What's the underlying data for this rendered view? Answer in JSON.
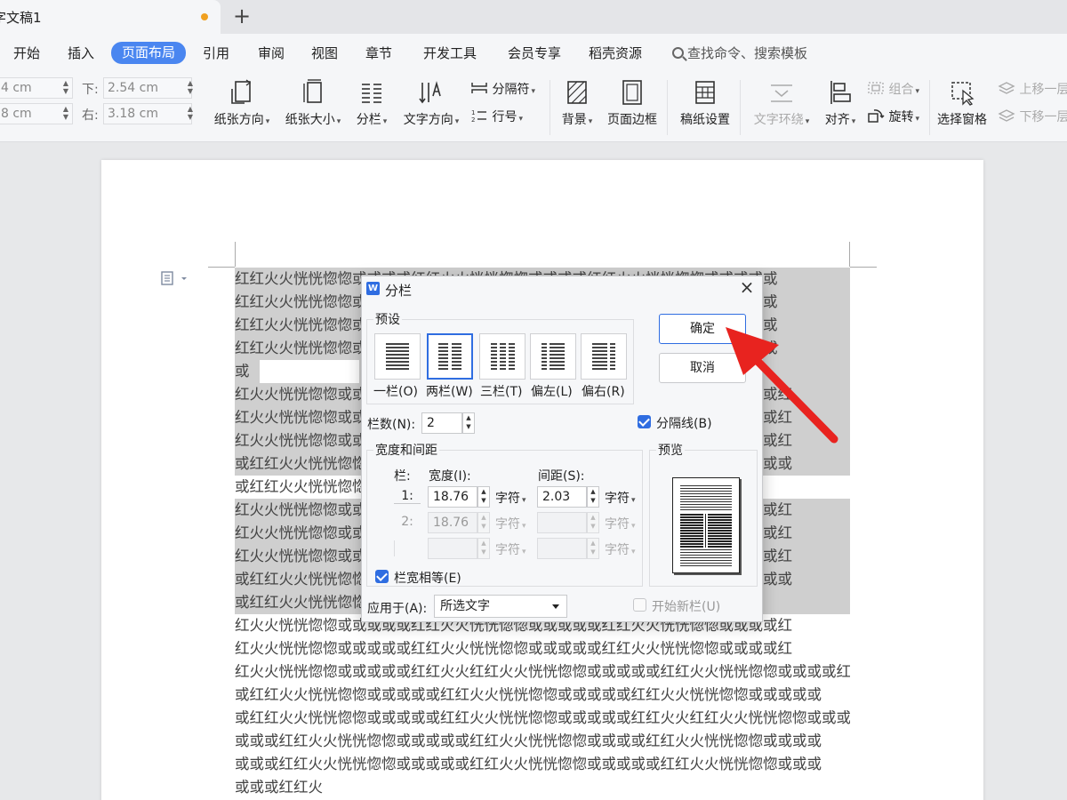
{
  "tabs": {
    "doc_title": "字文稿1",
    "new_tab": "+"
  },
  "menu": {
    "items": [
      "开始",
      "插入",
      "页面布局",
      "引用",
      "审阅",
      "视图",
      "章节",
      "开发工具",
      "会员专享",
      "稻壳资源"
    ],
    "active": "页面布局",
    "search": "查找命令、搜索模板"
  },
  "ribbon": {
    "margins": {
      "top_val": "4 cm",
      "left_val": "8 cm",
      "bottom_label": "下:",
      "bottom_val": "2.54 cm",
      "right_label": "右:",
      "right_val": "3.18 cm"
    },
    "orientation": "纸张方向",
    "size": "纸张大小",
    "columns": "分栏",
    "text_direction": "文字方向",
    "separator": "分隔符",
    "line_number": "行号",
    "background": "背景",
    "page_border": "页面边框",
    "grid_paper": "稿纸设置",
    "text_wrap": "文字环绕",
    "align": "对齐",
    "group": "组合",
    "rotate": "旋转",
    "selection_pane": "选择窗格",
    "bring_forward": "上移一层",
    "send_backward": "下移一层"
  },
  "document": {
    "lines": [
      "红红火火恍恍惚惚或或或或红红火火恍恍惚惚或或或或红红火火恍恍惚惚或或或或或",
      "红红火火恍恍惚惚或或或或红红火火恍恍惚惚或或或或红红火火恍恍惚惚或或或或或",
      "红红火火恍恍惚惚或或或或红红火火恍恍惚惚或或或或红红火火恍恍惚惚或或或或或",
      "红红火火恍恍惚惚或或或或红红火火恍恍惚惚或或或或红红火火恍恍惚惚或或或或或",
      "或",
      "红火火恍恍惚惚或或或或或红红火火恍恍惚惚或或或或或红红火火恍恍惚惚或或或或红",
      "红火火恍恍惚惚或或或或或红红火火恍恍惚惚或或或或或红红火火恍恍惚惚或或或或红",
      "红火火恍恍惚惚或或或或或红红火火恍恍惚惚或或或或或红红火火恍恍惚惚或或或或红",
      "或红红火火恍恍惚惚或或或或红红火火恍恍惚惚或或或或红红火火恍恍惚惚或或或或或",
      "或红红火火恍恍惚惚或或或或红红火火恍恍惚惚或或或或",
      "红火火恍恍惚惚或或或或或红红火火恍恍惚惚或或或或或红红火火恍恍惚惚或或或或红",
      "红火火恍恍惚惚或或或或或红红火火恍恍惚惚或或或或或红红火火恍恍惚惚或或或或红",
      "红火火恍恍惚惚或或或或或红红火火恍恍惚惚或或或或或红红火火恍恍惚惚或或或或红",
      "或红红火火恍恍惚惚或或或或红红火火恍恍惚惚或或或或红红火火恍恍惚惚或或或或或",
      "或红红火火恍恍惚惚或或或或红红火火恍恍惚惚或或或或",
      "红火火恍恍惚惚或或或或或红红火火恍恍惚惚或或或或或红红火火恍恍惚惚或或或或红",
      "红火火恍恍惚惚或或或或或红红火火恍恍惚惚或或或或或红红火火恍恍惚惚或或或或红",
      "红火火恍恍惚惚或或或或或红红火火红红火火恍恍惚惚或或或或或红红火火恍恍惚惚或或或或红",
      "或红红火火恍恍惚惚或或或或或红红火火恍恍惚惚或或或或或红红火火恍恍惚惚或或或或或",
      "或红红火火恍恍惚惚或或或或或红红火火恍恍惚惚或或或或或红红火火红红火火恍恍惚惚或或或",
      "或或或红红火火恍恍惚惚或或或或或红红火火恍恍惚惚或或或或红红火火恍恍惚惚或或或或",
      "或或或红红火火恍恍惚惚或或或或或红红火火恍恍惚惚或或或或或红红火火恍恍惚惚或或或",
      "或或或红红火"
    ]
  },
  "dialog": {
    "title": "分栏",
    "title_icon": "W",
    "close": "×",
    "presets_title": "预设",
    "presets": [
      "一栏(O)",
      "两栏(W)",
      "三栏(T)",
      "偏左(L)",
      "偏右(R)"
    ],
    "selected_preset": "两栏(W)",
    "ok": "确定",
    "cancel": "取消",
    "num_cols_label": "栏数(N):",
    "num_cols": "2",
    "separator_label": "分隔线(B)",
    "separator_checked": true,
    "width_spacing_title": "宽度和间距",
    "col_header": "栏:",
    "width_header": "宽度(I):",
    "spacing_header": "间距(S):",
    "rows": [
      {
        "col": "1:",
        "width": "18.76",
        "unit": "字符",
        "spacing": "2.03",
        "unit2": "字符"
      },
      {
        "col": "2:",
        "width": "18.76",
        "unit": "字符",
        "spacing": "",
        "unit2": "字符"
      },
      {
        "col": "",
        "width": "",
        "unit": "字符",
        "spacing": "",
        "unit2": "字符"
      }
    ],
    "equal_width_label": "栏宽相等(E)",
    "equal_width_checked": true,
    "preview_title": "预览",
    "apply_label": "应用于(A):",
    "apply_value": "所选文字",
    "new_column_label": "开始新栏(U)",
    "new_column_checked": false
  },
  "colors": {
    "accent": "#2f6de1",
    "menu_active": "#4a86f0",
    "arrow": "#e8231f",
    "selection": "#cfcfcf"
  }
}
